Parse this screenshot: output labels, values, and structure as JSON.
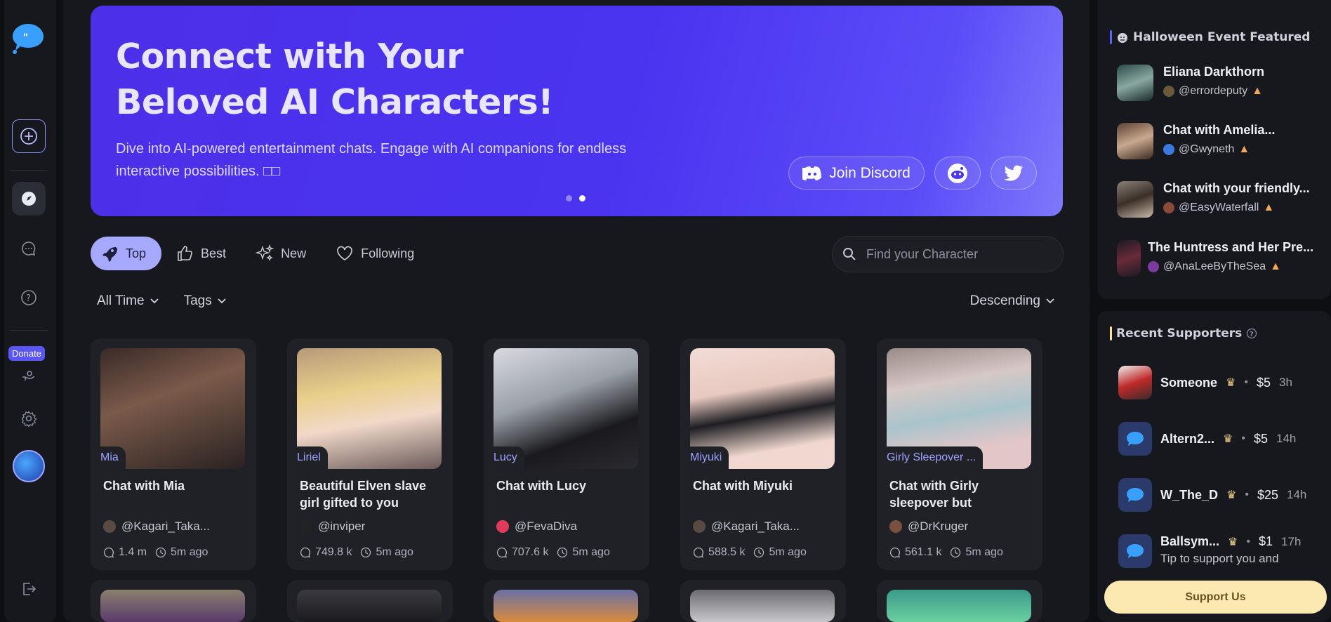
{
  "sidebar": {
    "donate_label": "Donate"
  },
  "hero": {
    "title_line1": "Connect with Your",
    "title_line2": "Beloved AI Characters!",
    "description": "Dive into AI-powered entertainment chats. Engage with AI companions for endless interactive possibilities. □□",
    "discord_label": "Join Discord"
  },
  "tabs": [
    {
      "label": "Top",
      "icon": "rocket-icon",
      "active": true
    },
    {
      "label": "Best",
      "icon": "thumbs-up-icon"
    },
    {
      "label": "New",
      "icon": "sparkles-icon"
    },
    {
      "label": "Following",
      "icon": "heart-icon"
    }
  ],
  "search": {
    "placeholder": "Find your Character"
  },
  "filters": {
    "time": "All Time",
    "tags": "Tags",
    "sort": "Descending"
  },
  "cards": [
    {
      "tag": "Mia",
      "title": "Chat with Mia",
      "author": "@Kagari_Taka...",
      "messages": "1.4 m",
      "updated": "5m ago"
    },
    {
      "tag": "Liriel",
      "title": "Beautiful Elven slave girl gifted to you",
      "author": "@inviper",
      "messages": "749.8 k",
      "updated": "5m ago"
    },
    {
      "tag": "Lucy",
      "title": "Chat with Lucy",
      "author": "@FevaDiva",
      "messages": "707.6 k",
      "updated": "5m ago"
    },
    {
      "tag": "Miyuki",
      "title": "Chat with Miyuki",
      "author": "@Kagari_Taka...",
      "messages": "588.5 k",
      "updated": "5m ago"
    },
    {
      "tag": "Girly Sleepover ...",
      "title": "Chat with Girly sleepover but",
      "author": "@DrKruger",
      "messages": "561.1 k",
      "updated": "5m ago"
    }
  ],
  "featured": {
    "title": "Halloween Event Featured",
    "items": [
      {
        "name": "Eliana Darkthorn",
        "handle": "@errordeputy"
      },
      {
        "name": "Chat with Amelia...",
        "handle": "@Gwyneth"
      },
      {
        "name": "Chat with your friendly...",
        "handle": "@EasyWaterfall"
      },
      {
        "name": "The Huntress and Her Pre...",
        "handle": "@AnaLeeByTheSea"
      }
    ]
  },
  "supporters": {
    "title": "Recent Supporters",
    "items": [
      {
        "name": "Someone",
        "amount": "$5",
        "time": "3h"
      },
      {
        "name": "Altern2...",
        "amount": "$5",
        "time": "14h"
      },
      {
        "name": "W_The_D",
        "amount": "$25",
        "time": "14h"
      },
      {
        "name": "Ballsym...",
        "amount": "$1",
        "time": "17h",
        "note": "Tip to support you and"
      }
    ],
    "button_label": "Support Us"
  }
}
